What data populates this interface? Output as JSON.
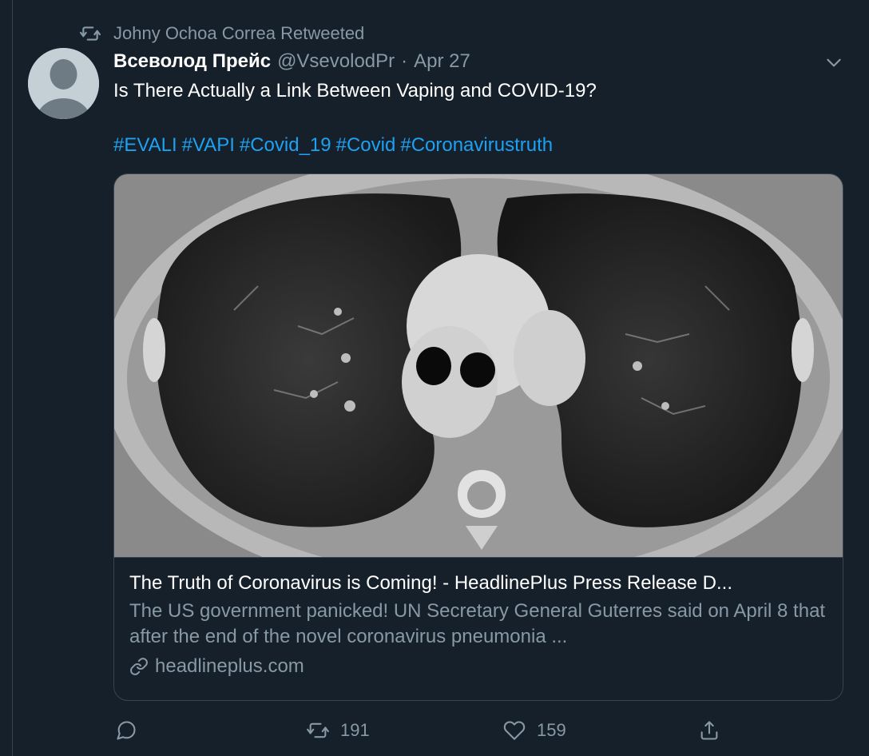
{
  "retweet_banner": {
    "text": "Johny Ochoa Correa Retweeted",
    "icon": "retweet-icon"
  },
  "tweet": {
    "display_name": "Всеволод Прейс",
    "handle": "@VsevolodPr",
    "separator": "·",
    "date": "Apr 27",
    "text": "Is There Actually a Link Between Vaping and COVID-19?",
    "hashtags": [
      "#EVALI",
      "#VAPI",
      "#Covid_19",
      "#Covid",
      "#Coronavirustruth"
    ]
  },
  "card": {
    "image": "lung-ct-scan-image",
    "title": "The Truth of Coronavirus is Coming! - HeadlinePlus Press Release D...",
    "description": "The US government panicked! UN Secretary General Guterres said on April 8 that after the end of the novel coronavirus pneumonia ...",
    "domain": "headlineplus.com",
    "link_icon": "link-icon"
  },
  "actions": {
    "reply": {
      "icon": "reply-icon",
      "count": ""
    },
    "retweet": {
      "icon": "retweet-icon",
      "count": "191"
    },
    "like": {
      "icon": "heart-icon",
      "count": "159"
    },
    "share": {
      "icon": "share-icon",
      "count": ""
    }
  },
  "colors": {
    "background": "#15202b",
    "text_primary": "#ffffff",
    "text_secondary": "#8899a6",
    "link": "#1da1f2",
    "border": "#38444d"
  }
}
